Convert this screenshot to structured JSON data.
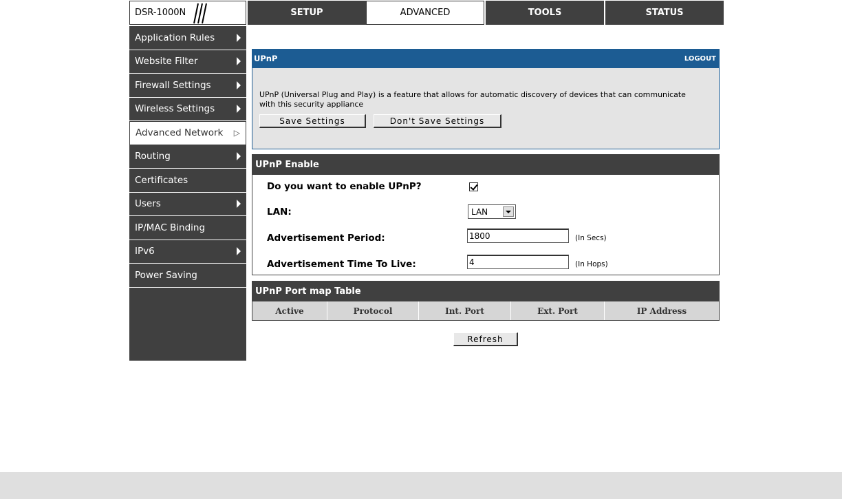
{
  "header": {
    "model": "DSR-1000N",
    "tabs": [
      {
        "label": "SETUP",
        "active": false
      },
      {
        "label": "ADVANCED",
        "active": true
      },
      {
        "label": "TOOLS",
        "active": false
      },
      {
        "label": "STATUS",
        "active": false
      }
    ]
  },
  "sidebar": {
    "items": [
      {
        "label": "Application Rules",
        "arrow": true
      },
      {
        "label": "Website Filter",
        "arrow": true
      },
      {
        "label": "Firewall Settings",
        "arrow": true
      },
      {
        "label": "Wireless Settings",
        "arrow": true
      },
      {
        "label": "Advanced Network",
        "arrow": true,
        "active": true
      },
      {
        "label": "Routing",
        "arrow": true
      },
      {
        "label": "Certificates",
        "arrow": false
      },
      {
        "label": "Users",
        "arrow": true
      },
      {
        "label": "IP/MAC Binding",
        "arrow": false
      },
      {
        "label": "IPv6",
        "arrow": true
      },
      {
        "label": "Power Saving",
        "arrow": false
      }
    ]
  },
  "upnp": {
    "title": "UPnP",
    "logout": "LOGOUT",
    "description": "UPnP (Universal Plug and Play) is a feature that allows for automatic discovery of devices that can communicate with this security appliance",
    "save_label": "Save Settings",
    "dont_save_label": "Don't Save Settings"
  },
  "enable": {
    "title": "UPnP Enable",
    "enable_label": "Do you want to enable UPnP?",
    "enable_checked": true,
    "lan_label": "LAN:",
    "lan_value": "LAN",
    "period_label": "Advertisement Period:",
    "period_value": "1800",
    "period_unit": "(In Secs)",
    "ttl_label": "Advertisement Time To Live:",
    "ttl_value": "4",
    "ttl_unit": "(In Hops)"
  },
  "portmap": {
    "title": "UPnP Port map Table",
    "columns": [
      "Active",
      "Protocol",
      "Int. Port",
      "Ext. Port",
      "IP Address"
    ],
    "refresh_label": "Refresh"
  },
  "colors": {
    "nav_dark": "#404040",
    "header_blue": "#1c5c93",
    "panel_grey": "#e4e4e4"
  }
}
